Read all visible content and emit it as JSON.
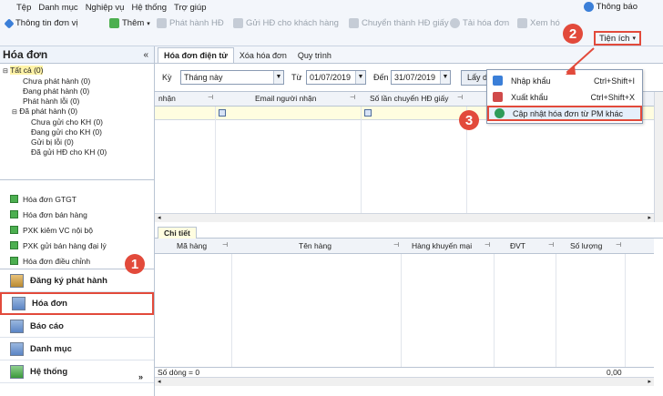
{
  "menubar": {
    "items": [
      "Tệp",
      "Danh mục",
      "Nghiệp vụ",
      "Hệ thống",
      "Trợ giúp"
    ]
  },
  "toolbar": {
    "company_info": "Thông tin đơn vị",
    "add": "Thêm",
    "issue_invoice": "Phát hành HĐ",
    "send_invoice": "Gửi HĐ cho khách hàng",
    "convert_paper": "Chuyển thành HĐ giấy",
    "download_invoice": "Tải hóa đơn",
    "view": "Xem hó",
    "notifications": "Thông báo",
    "utilities": "Tiện ích"
  },
  "left_panel": {
    "title": "Hóa đơn",
    "collapse": "«",
    "tree": [
      "Tất cả (0)",
      "Chưa phát hành (0)",
      "Đang phát hành (0)",
      "Phát hành lỗi (0)",
      "Đã phát hành (0)",
      "Chưa gửi cho KH (0)",
      "Đang gửi cho KH (0)",
      "Gửi bị lỗi (0)",
      "Đã gửi HĐ cho KH (0)"
    ],
    "nav_items": [
      "Hóa đơn GTGT",
      "Hóa đơn bán hàng",
      "PXK kiêm VC nội bộ",
      "PXK gửi bán hàng đại lý",
      "Hóa đơn điều chỉnh"
    ],
    "modules": [
      "Đăng ký phát hành",
      "Hóa đơn",
      "Báo cáo",
      "Danh mục",
      "Hệ thống"
    ],
    "expand": "»"
  },
  "tabs": [
    "Hóa đơn điện tử",
    "Xóa hóa đơn",
    "Quy trình"
  ],
  "filter": {
    "period_label": "Kỳ",
    "period_value": "Tháng này",
    "from_label": "Từ",
    "from_value": "01/07/2019",
    "to_label": "Đến",
    "to_value": "31/07/2019",
    "fetch_button": "Lấy d"
  },
  "grid": {
    "columns": [
      "nhận",
      "Email người nhận",
      "Số lần chuyển HĐ giấy"
    ]
  },
  "detail": {
    "tab": "Chi tiết",
    "columns": [
      "Mã hàng",
      "Tên hàng",
      "Hàng khuyến mại",
      "ĐVT",
      "Số lượng"
    ],
    "row_count": "Số dòng = 0",
    "total": "0,00"
  },
  "menu": {
    "items": [
      {
        "label": "Nhập khẩu",
        "shortcut": "Ctrl+Shift+I"
      },
      {
        "label": "Xuất khẩu",
        "shortcut": "Ctrl+Shift+X"
      },
      {
        "label": "Cập nhật hóa đơn từ PM khác",
        "shortcut": ""
      }
    ]
  },
  "callouts": [
    "1",
    "2",
    "3"
  ],
  "colors": {
    "callout": "#e24a3b",
    "highlight": "#e24a3b",
    "tree_selected": "#fff3a8"
  }
}
